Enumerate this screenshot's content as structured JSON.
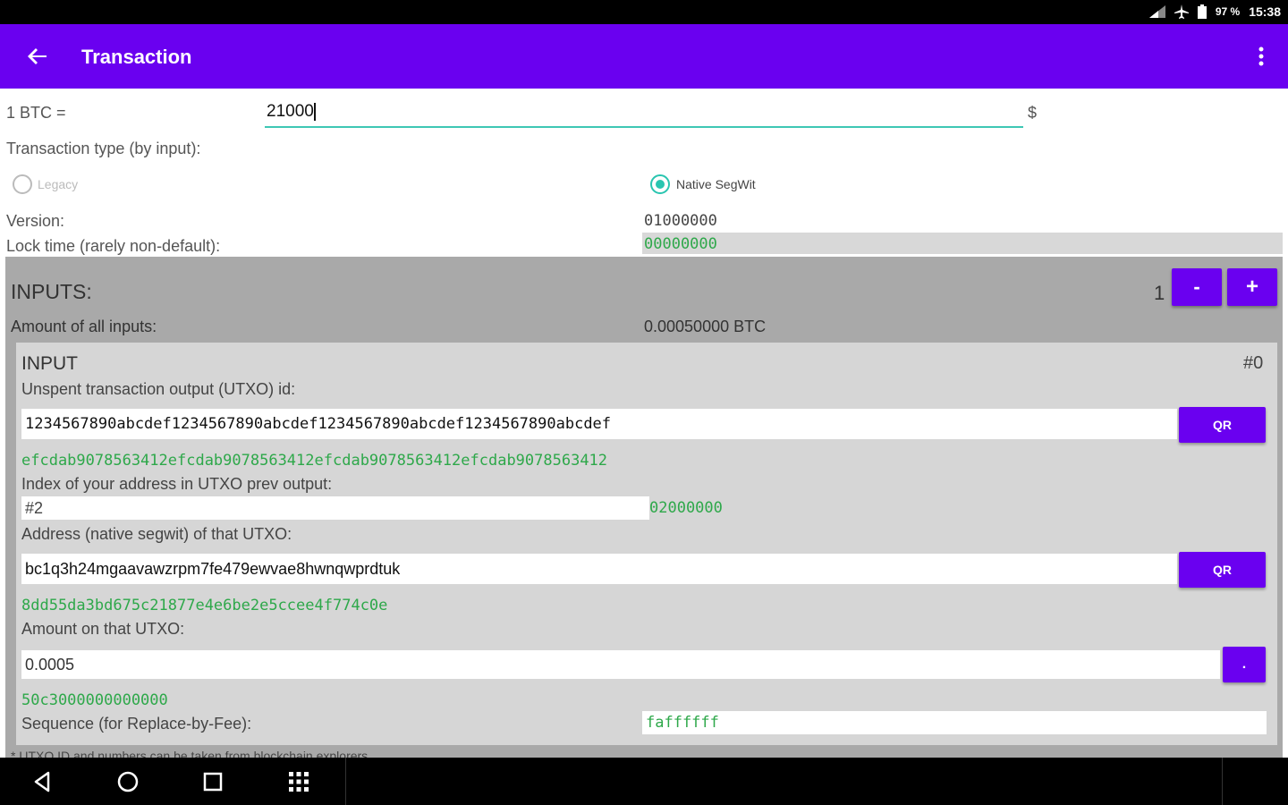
{
  "status_bar": {
    "battery": "97 %",
    "time": "15:38",
    "icons": [
      "signal-icon",
      "airplane-icon",
      "battery-icon"
    ]
  },
  "app_bar": {
    "title": "Transaction",
    "icons": [
      "back-arrow-icon",
      "overflow-menu-icon"
    ]
  },
  "rate": {
    "label": "1 BTC =",
    "value": "21000",
    "currency": "$"
  },
  "tx_type": {
    "label": "Transaction type (by input):",
    "options": [
      {
        "label": "Legacy",
        "selected": false
      },
      {
        "label": "Native SegWit",
        "selected": true
      }
    ]
  },
  "version": {
    "label": "Version:",
    "value": "01000000"
  },
  "lock_time": {
    "label": "Lock time (rarely non-default):",
    "value": "00000000"
  },
  "inputs": {
    "title": "INPUTS:",
    "count": "1",
    "minus_label": "-",
    "plus_label": "+",
    "amount_label": "Amount of all inputs:",
    "amount_value": "0.00050000 BTC",
    "input": {
      "title": "INPUT",
      "index": "#0",
      "utxo_label": "Unspent transaction output (UTXO) id:",
      "utxo_value": "1234567890abcdef1234567890abcdef1234567890abcdef1234567890abcdef",
      "utxo_qr": "QR",
      "utxo_hex": "efcdab9078563412efcdab9078563412efcdab9078563412efcdab9078563412",
      "index_label": "Index of your address in UTXO prev output:",
      "index_value": "#2",
      "index_hex": "02000000",
      "address_label": "Address (native segwit) of that UTXO:",
      "address_value": "bc1q3h24mgaavawzrpm7fe479ewvae8hwnqwprdtuk",
      "address_qr": "QR",
      "address_hex": "8dd55da3bd675c21877e4e6be2e5ccee4f774c0e",
      "amount_label": "Amount on that UTXO:",
      "amount_value": "0.0005",
      "amount_btn": ".",
      "amount_hex": "50c3000000000000",
      "sequence_label": "Sequence (for Replace-by-Fee):",
      "sequence_value": "faffffff"
    },
    "footnote": "* UTXO ID and numbers can be taken from blockchain explorers"
  },
  "nav_bar": {
    "icons": [
      "back-triangle-icon",
      "home-circle-icon",
      "recents-square-icon",
      "apps-grid-icon"
    ]
  },
  "colors": {
    "accent": "#6a00f0",
    "teal": "#29c5b0",
    "hex_green": "#2ea84a"
  }
}
